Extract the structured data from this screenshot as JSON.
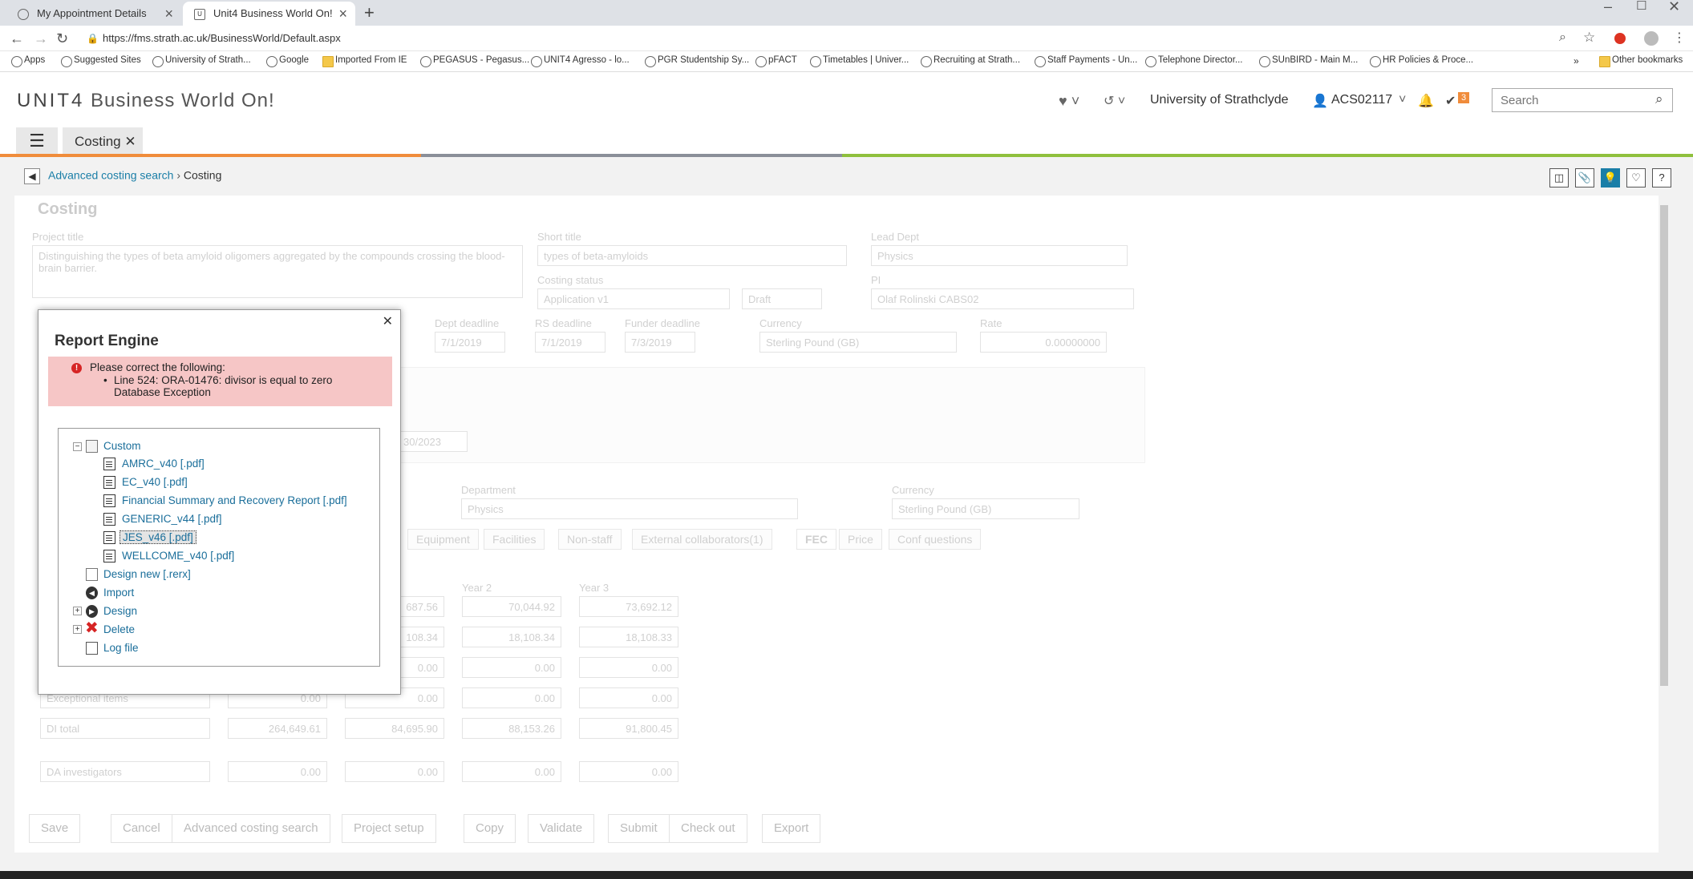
{
  "browser": {
    "tabs": [
      {
        "label": "My Appointment Details"
      },
      {
        "label": "Unit4 Business World On!"
      }
    ],
    "url": "https://fms.strath.ac.uk/BusinessWorld/Default.aspx",
    "bookmarks": [
      "Apps",
      "Suggested Sites",
      "University of Strath...",
      "Google",
      "Imported From IE",
      "PEGASUS - Pegasus...",
      "UNIT4 Agresso - lo...",
      "PGR Studentship Sy...",
      "pFACT",
      "Timetables | Univer...",
      "Recruiting at Strath...",
      "Staff Payments - Un...",
      "Telephone Director...",
      "SUnBIRD - Main M...",
      "HR Policies & Proce..."
    ],
    "other_bookmarks": "Other bookmarks"
  },
  "app": {
    "logo_brand": "UNIT4",
    "logo_product": "Business World On!",
    "organisation": "University of Strathclyde",
    "user": "ACS02117",
    "task_count": "3",
    "search_placeholder": "Search",
    "tab": "Costing"
  },
  "breadcrumb": {
    "parent": "Advanced costing search",
    "current": "Costing"
  },
  "form": {
    "heading": "Costing",
    "project_title_label": "Project title",
    "project_title": "Distinguishing the types of beta amyloid oligomers aggregated  by the compounds crossing the blood-brain barrier.",
    "short_title_label": "Short title",
    "short_title": "types of beta-amyloids",
    "lead_dept_label": "Lead Dept",
    "lead_dept": "Physics",
    "costing_status_label": "Costing status",
    "costing_status": "Application v1",
    "status_value": "Draft",
    "pi_label": "PI",
    "pi": "Olaf Rolinski CABS02",
    "dept_deadline_label": "Dept deadline",
    "dept_deadline": "7/1/2019",
    "rs_deadline_label": "RS deadline",
    "rs_deadline": "7/1/2019",
    "funder_deadline_label": "Funder deadline",
    "funder_deadline": "7/3/2019",
    "currency_label": "Currency",
    "currency": "Sterling Pound (GB)",
    "rate_label": "Rate",
    "rate": "0.00000000",
    "date_partial": "30/2023",
    "department_label": "Department",
    "department": "Physics",
    "currency2_label": "Currency",
    "currency2": "Sterling Pound (GB)",
    "subtabs": [
      "Equipment",
      "Facilities",
      "Non-staff",
      "External collaborators(1)",
      "FEC",
      "Price",
      "Conf questions"
    ],
    "year2_label": "Year 2",
    "year3_label": "Year 3",
    "rows": [
      {
        "label": "",
        "total": "",
        "y1": "687.56",
        "y2": "70,044.92",
        "y3": "73,692.12"
      },
      {
        "label": "",
        "total": "",
        "y1": "108.34",
        "y2": "18,108.34",
        "y3": "18,108.33"
      },
      {
        "label": "",
        "total": "",
        "y1": "0.00",
        "y2": "0.00",
        "y3": "0.00"
      },
      {
        "label": "Exceptional items",
        "total": "0.00",
        "y1": "0.00",
        "y2": "0.00",
        "y3": "0.00"
      },
      {
        "label": "DI total",
        "total": "264,649.61",
        "y1": "84,695.90",
        "y2": "88,153.26",
        "y3": "91,800.45"
      },
      {
        "label": "DA investigators",
        "total": "0.00",
        "y1": "0.00",
        "y2": "0.00",
        "y3": "0.00"
      }
    ]
  },
  "footer": {
    "save": "Save",
    "cancel": "Cancel",
    "advanced": "Advanced costing search",
    "project_setup": "Project setup",
    "copy": "Copy",
    "validate": "Validate",
    "submit": "Submit",
    "check_out": "Check out",
    "export": "Export"
  },
  "modal": {
    "title": "Report Engine",
    "error_heading": "Please correct the following:",
    "error_line": "Line 524: ORA-01476: divisor is equal to zero",
    "error_exception": "Database Exception",
    "tree": {
      "custom": "Custom",
      "reports": [
        "AMRC_v40 [.pdf]",
        "EC_v40 [.pdf]",
        "Financial Summary and Recovery Report [.pdf]",
        "GENERIC_v44 [.pdf]",
        "JES_v46 [.pdf]",
        "WELLCOME_v40 [.pdf]"
      ],
      "design_new": "Design new [.rerx]",
      "import": "Import",
      "design": "Design",
      "delete": "Delete",
      "log_file": "Log file"
    }
  },
  "colors": {
    "accent_blue": "#1a7ea7",
    "error_bg": "#f6c6c6",
    "orange": "#f08c3b",
    "green": "#8fc03d"
  }
}
